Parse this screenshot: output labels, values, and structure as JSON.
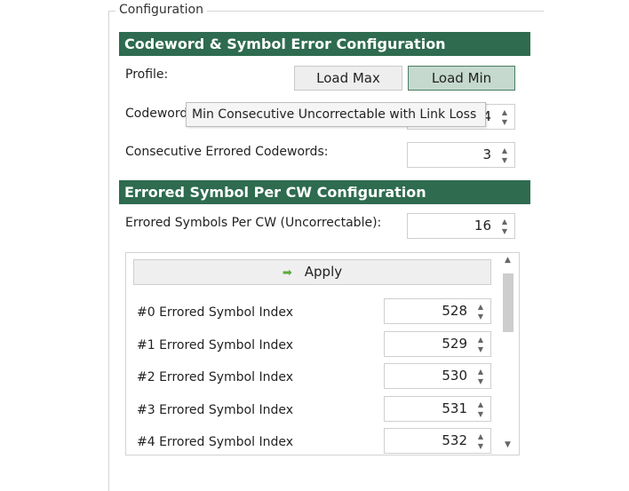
{
  "group_title": "Configuration",
  "section1": {
    "title": "Codeword & Symbol Error Configuration",
    "profile_label": "Profile:",
    "load_max": "Load Max",
    "load_min": "Load Min",
    "codewords_label": "Codewords",
    "codewords_value": "4",
    "tooltip": "Min Consecutive Uncorrectable with Link Loss",
    "consecutive_label": "Consecutive Errored Codewords:",
    "consecutive_value": "3"
  },
  "section2": {
    "title": "Errored Symbol Per CW Configuration",
    "symbols_label": "Errored Symbols Per CW (Uncorrectable):",
    "symbols_value": "16",
    "apply": "Apply",
    "rows": [
      {
        "label": "#0 Errored Symbol Index",
        "value": "528"
      },
      {
        "label": "#1 Errored Symbol Index",
        "value": "529"
      },
      {
        "label": "#2 Errored Symbol Index",
        "value": "530"
      },
      {
        "label": "#3 Errored Symbol Index",
        "value": "531"
      },
      {
        "label": "#4 Errored Symbol Index",
        "value": "532"
      }
    ]
  },
  "colors": {
    "header": "#2e6b4f",
    "active_button": "#c5d9cf",
    "apply_icon": "#5aaa3a"
  }
}
